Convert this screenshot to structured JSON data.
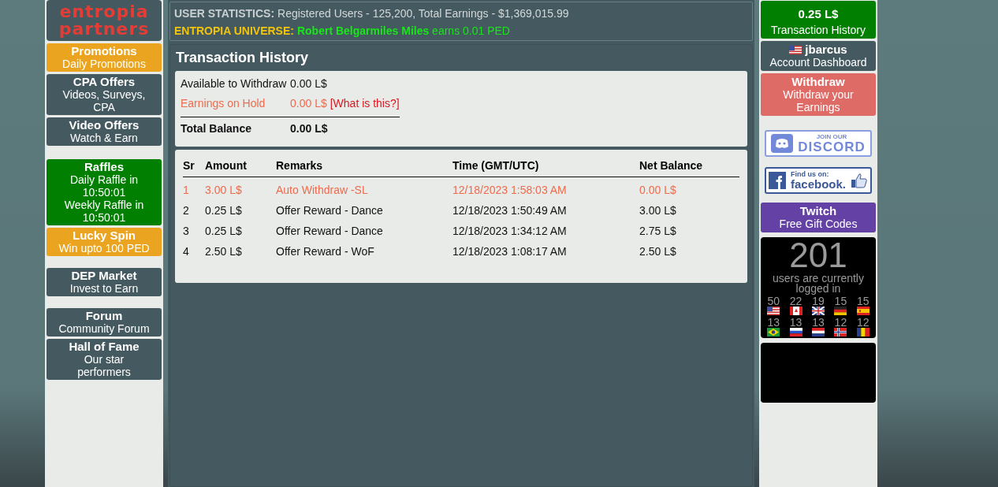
{
  "logo": {
    "lines": [
      "entropia",
      "partners"
    ]
  },
  "left_nav": {
    "groups": [
      [
        {
          "title": "Promotions",
          "lines": [
            "Daily Promotions"
          ],
          "color": "#eba41f"
        },
        {
          "title": "CPA Offers",
          "lines": [
            "Videos, Surveys, CPA"
          ],
          "color": "#455a60"
        },
        {
          "title": "Video Offers",
          "lines": [
            "Watch & Earn"
          ],
          "color": "#455a60"
        }
      ],
      [
        {
          "title": "Raffles",
          "lines": [
            "Daily Raffle in 10:50:01",
            "Weekly Raffle in 10:50:01"
          ],
          "color": "#007f00"
        },
        {
          "title": "Lucky Spin",
          "lines": [
            "Win upto 100 PED"
          ],
          "color": "#eba41f"
        }
      ],
      [
        {
          "title": "DEP Market",
          "lines": [
            "Invest to Earn"
          ],
          "color": "#455a60"
        }
      ],
      [
        {
          "title": "Forum",
          "lines": [
            "Community Forum"
          ],
          "color": "#455a60"
        },
        {
          "title": "Hall of Fame",
          "lines": [
            "Our star performers"
          ],
          "color": "#455a60"
        }
      ]
    ]
  },
  "stats_bar": {
    "label": "USER STATISTICS:",
    "text": "Registered Users - 125,200, Total Earnings - $1,369,015.99"
  },
  "news_bar": {
    "label": "ENTROPIA UNIVERSE:",
    "text": "**Robert Belgarmiles Miles** earns 0.01 PED"
  },
  "panel": {
    "title": "Transaction History",
    "summary": [
      {
        "kind": "normal",
        "label": "Available to Withdraw",
        "value": "0.00 L$"
      },
      {
        "kind": "hold",
        "label": "Earnings on Hold",
        "value": "0.00 L$",
        "link": "[What is this?]"
      },
      {
        "kind": "total",
        "label": "Total Balance",
        "value": "0.00 L$"
      }
    ],
    "table": {
      "columns": [
        "Sr",
        "Amount",
        "Remarks",
        "Time (GMT/UTC)",
        "Net Balance"
      ],
      "rows": [
        {
          "kind": "withdraw",
          "cells": [
            "1",
            "3.00 L$",
            "Auto Withdraw -SL",
            "12/18/2023 1:58:03 AM",
            "0.00 L$"
          ]
        },
        {
          "kind": "reward",
          "cells": [
            "2",
            "0.25 L$",
            "Offer Reward - Dance",
            "12/18/2023 1:50:49 AM",
            "3.00 L$"
          ]
        },
        {
          "kind": "reward",
          "cells": [
            "3",
            "0.25 L$",
            "Offer Reward - Dance",
            "12/18/2023 1:34:12 AM",
            "2.75 L$"
          ]
        },
        {
          "kind": "reward",
          "cells": [
            "4",
            "2.50 L$",
            "Offer Reward - WoF",
            "12/18/2023 1:08:17 AM",
            "2.50 L$"
          ]
        }
      ]
    }
  },
  "right_nav": [
    {
      "kind": "tile",
      "title": "0.25 L$",
      "lines": [
        "Transaction History"
      ],
      "color": "#007f00"
    },
    {
      "kind": "account",
      "title": "jbarcus",
      "lines": [
        "Account Dashboard"
      ],
      "color": "#455a60"
    },
    {
      "kind": "tile",
      "title": "Withdraw",
      "lines": [
        "Withdraw your Earnings"
      ],
      "color": "#de6b65"
    },
    {
      "kind": "discord",
      "small": "JOIN OUR",
      "big": "DISCORD"
    },
    {
      "kind": "facebook",
      "small": "Find us on:",
      "big": "facebook."
    },
    {
      "kind": "tile",
      "title": "Twitch",
      "lines": [
        "Free Gift Codes"
      ],
      "color": "#6441a5"
    }
  ],
  "online": {
    "count": "201",
    "label": "users are currently logged in",
    "countries": [
      {
        "kind": "us",
        "count": "50"
      },
      {
        "kind": "ca",
        "count": "22"
      },
      {
        "kind": "gb",
        "count": "19"
      },
      {
        "kind": "de",
        "count": "15"
      },
      {
        "kind": "es",
        "count": "15"
      },
      {
        "kind": "br",
        "count": "13"
      },
      {
        "kind": "ru",
        "count": "13"
      },
      {
        "kind": "nl",
        "count": "13"
      },
      {
        "kind": "no",
        "count": "12"
      },
      {
        "kind": "ro",
        "count": "12"
      }
    ]
  }
}
